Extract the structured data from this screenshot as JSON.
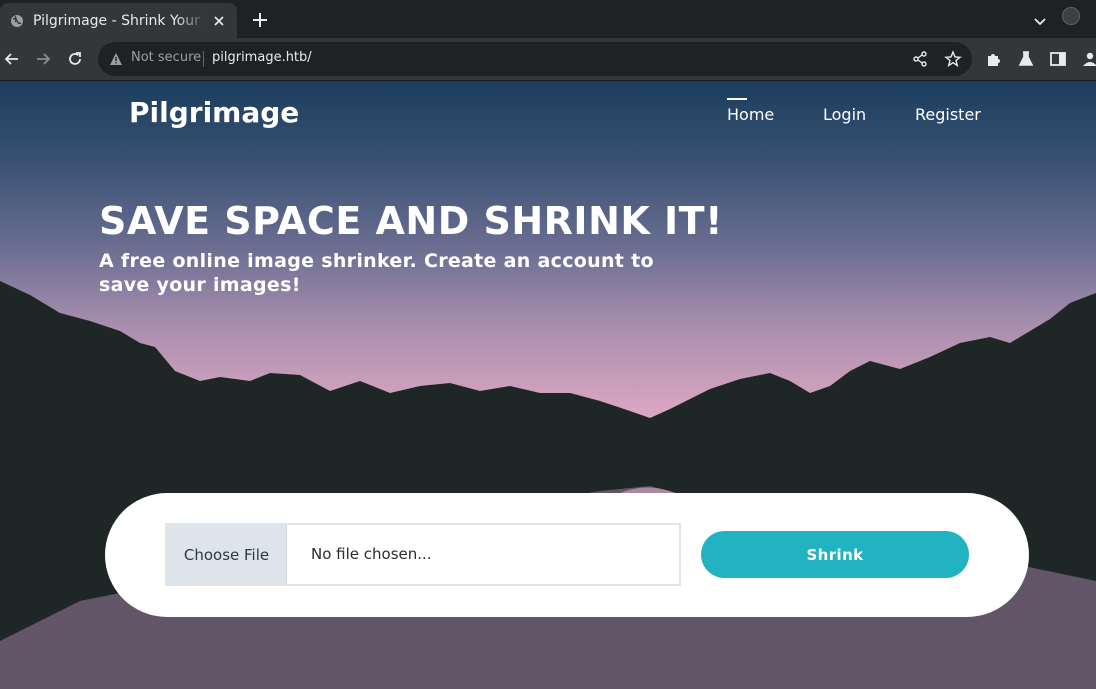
{
  "browser": {
    "tab_title": "Pilgrimage - Shrink Your Images",
    "security_label": "Not secure",
    "url": "pilgrimage.htb/"
  },
  "site": {
    "brand": "Pilgrimage",
    "nav": [
      {
        "label": "Home",
        "active": true
      },
      {
        "label": "Login",
        "active": false
      },
      {
        "label": "Register",
        "active": false
      }
    ],
    "hero_title": "SAVE SPACE AND SHRINK IT!",
    "hero_subtitle": "A free online image shrinker. Create an account to save your images!",
    "upload": {
      "choose_label": "Choose File",
      "file_status": "No file chosen...",
      "submit_label": "Shrink"
    }
  },
  "colors": {
    "accent": "#22b3c2",
    "mountain": "#1f2626"
  },
  "icons": [
    "globe-icon",
    "close-icon",
    "plus-icon",
    "chevron-down-icon",
    "back-arrow-icon",
    "forward-arrow-icon",
    "reload-icon",
    "warning-icon",
    "share-icon",
    "star-icon",
    "puzzle-icon",
    "flask-icon",
    "sidebar-icon",
    "person-icon"
  ]
}
